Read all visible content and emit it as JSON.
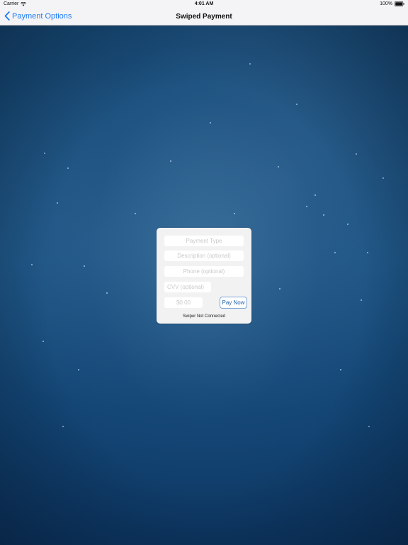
{
  "status_bar": {
    "carrier": "Carrier",
    "time": "4:01 AM",
    "battery": "100%"
  },
  "nav": {
    "back_label": "Payment Options",
    "title": "Swiped Payment"
  },
  "form": {
    "payment_type_placeholder": "Payment Type",
    "description_placeholder": "Description (optional)",
    "phone_placeholder": "Phone (optional)",
    "cvv_placeholder": "CVV (optional)",
    "amount_placeholder": "$0.00",
    "pay_button_label": "Pay Now",
    "swiper_status": "Swiper Not Connected"
  },
  "colors": {
    "accent": "#1f7cf2",
    "background": "#184c78",
    "card": "#f2f2f3"
  },
  "icons": {
    "wifi": "wifi-icon",
    "battery": "battery-icon",
    "back": "chevron-left-icon"
  }
}
